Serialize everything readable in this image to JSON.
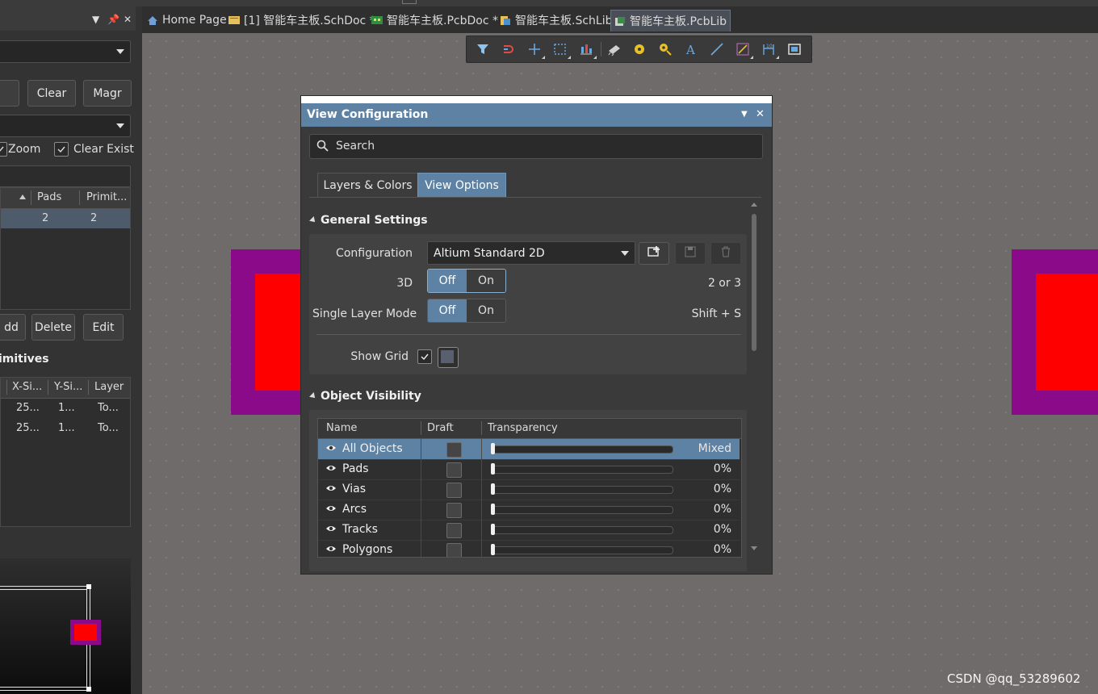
{
  "tabs": [
    {
      "label": "Home Page",
      "icon": "home-icon"
    },
    {
      "label": "[1] 智能车主板.SchDoc *",
      "icon": "schdoc-icon"
    },
    {
      "label": "智能车主板.PcbDoc *",
      "icon": "pcbdoc-icon"
    },
    {
      "label": "智能车主板.SchLib",
      "icon": "schlib-icon"
    },
    {
      "label": "智能车主板.PcbLib",
      "icon": "pcblib-icon"
    }
  ],
  "toolbar": {
    "icons": [
      "filter-icon",
      "route-icon",
      "add-icon",
      "select-rect-icon",
      "align-icon",
      "component-icon",
      "pad-icon",
      "via-icon",
      "text-icon",
      "line-icon",
      "measure-icon",
      "dimension-icon",
      "region-icon"
    ]
  },
  "left_panel": {
    "buttons": {
      "clear": "Clear",
      "magnify": "Magr",
      "add": "dd",
      "delete": "Delete",
      "edit": "Edit"
    },
    "checks": {
      "zoom": "Zoom",
      "clear_existing": "Clear Exist"
    },
    "components_table": {
      "headers": [
        "Pads",
        "Primit..."
      ],
      "rows": [
        [
          "2",
          "2"
        ]
      ]
    },
    "primitives_title": "imitives",
    "primitives_table": {
      "headers": [
        "X-Si...",
        "Y-Si...",
        "Layer"
      ],
      "rows": [
        [
          "25...",
          "1...",
          "To..."
        ],
        [
          "25...",
          "1...",
          "To..."
        ]
      ]
    }
  },
  "view_config": {
    "title": "View Configuration",
    "search_placeholder": "Search",
    "tabs": [
      "Layers & Colors",
      "View Options"
    ],
    "active_tab": "View Options",
    "general": {
      "title": "General Settings",
      "configuration_label": "Configuration",
      "configuration_value": "Altium Standard 2D",
      "three_d_label": "3D",
      "three_d_shortcut": "2 or 3",
      "single_layer_label": "Single Layer Mode",
      "single_layer_shortcut": "Shift + S",
      "off": "Off",
      "on": "On",
      "show_grid_label": "Show Grid"
    },
    "visibility": {
      "title": "Object Visibility",
      "headers": [
        "Name",
        "Draft",
        "Transparency"
      ],
      "rows": [
        {
          "name": "All Objects",
          "value": "Mixed"
        },
        {
          "name": "Pads",
          "value": "0%"
        },
        {
          "name": "Vias",
          "value": "0%"
        },
        {
          "name": "Arcs",
          "value": "0%"
        },
        {
          "name": "Tracks",
          "value": "0%"
        },
        {
          "name": "Polygons",
          "value": "0%"
        }
      ]
    }
  },
  "watermark": "CSDN @qq_53289602",
  "colors": {
    "accent": "#5e82a4",
    "pad_outer": "#8a0a8a",
    "pad_inner": "#ff0000"
  }
}
